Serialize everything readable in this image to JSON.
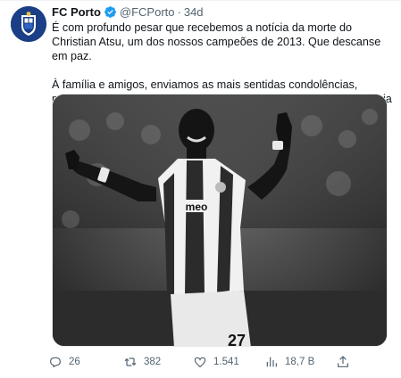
{
  "tweet": {
    "author_name": "FC Porto",
    "handle": "@FCPorto",
    "separator": "·",
    "time": "34d",
    "paragraph_1": "É com profundo pesar que recebemos a notícia da morte do Christian Atsu, um dos nossos campeões de 2013. Que descanse em paz.",
    "paragraph_2": "À família e amigos, enviamos as mais sentidas condolências, mensagem que estendemos a todas as vítimas do sismo da Turquia e Síria.",
    "media_alt": "Black and white photo of Christian Atsu celebrating with arms outstretched in an FC Porto shirt",
    "shirt_sponsor": "meo",
    "shirt_number": "27"
  },
  "actions": {
    "replies": "26",
    "retweets": "382",
    "likes": "1.541",
    "views": "18,7 B"
  },
  "icons": {
    "avatar": "fc-porto-crest-icon",
    "verified": "verified-badge-icon",
    "reply": "reply-icon",
    "retweet": "retweet-icon",
    "like": "heart-icon",
    "views": "views-chart-icon",
    "share": "share-icon"
  },
  "colors": {
    "text_primary": "#0f1419",
    "text_muted": "#536471",
    "verified_blue": "#1d9bf0",
    "avatar_blue": "#1b3f86"
  }
}
